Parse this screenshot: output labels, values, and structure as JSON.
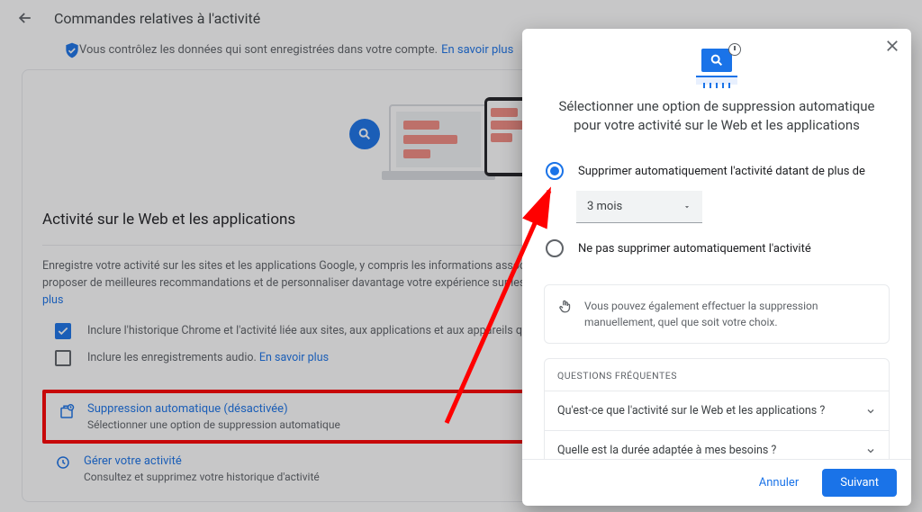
{
  "header": {
    "title": "Commandes relatives à l'activité"
  },
  "intro": {
    "text": "Vous contrôlez les données qui sont enregistrées dans votre compte.",
    "link": "En savoir plus"
  },
  "section": {
    "title": "Activité sur le Web et les applications",
    "desc": "Enregistre votre activité sur les sites et les applications Google, y compris les informations associées comme la position, afin d'accélérer vos recherches, de vous proposer de meilleures recommandations et de personnaliser davantage votre expérience sur les services Google, tels que Maps, la recherche Google, etc..",
    "desc_link": " En savoir plus",
    "chk1": "Inclure l'historique Chrome et l'activité liée aux sites, aux applications et aux appareils qui utilisent les services Google",
    "chk2": "Inclure les enregistrements audio.",
    "chk2_link": " En savoir plus"
  },
  "auto_delete": {
    "title": "Suppression automatique (désactivée)",
    "sub": "Sélectionner une option de suppression automatique"
  },
  "manage": {
    "title": "Gérer votre activité",
    "sub": "Consultez et supprimez votre historique d'activité"
  },
  "modal": {
    "title": "Sélectionner une option de suppression automatique pour votre activité sur le Web et les applications",
    "opt1": "Supprimer automatiquement l'activité datant de plus de",
    "select_value": "3 mois",
    "opt2": "Ne pas supprimer automatiquement l'activité",
    "note": "Vous pouvez également effectuer la suppression manuellement, quel que soit votre choix.",
    "faq_head": "QUESTIONS FRÉQUENTES",
    "faq1": "Qu'est-ce que l'activité sur le Web et les applications ?",
    "faq2": "Quelle est la durée adaptée à mes besoins ?",
    "cancel": "Annuler",
    "next": "Suivant"
  }
}
